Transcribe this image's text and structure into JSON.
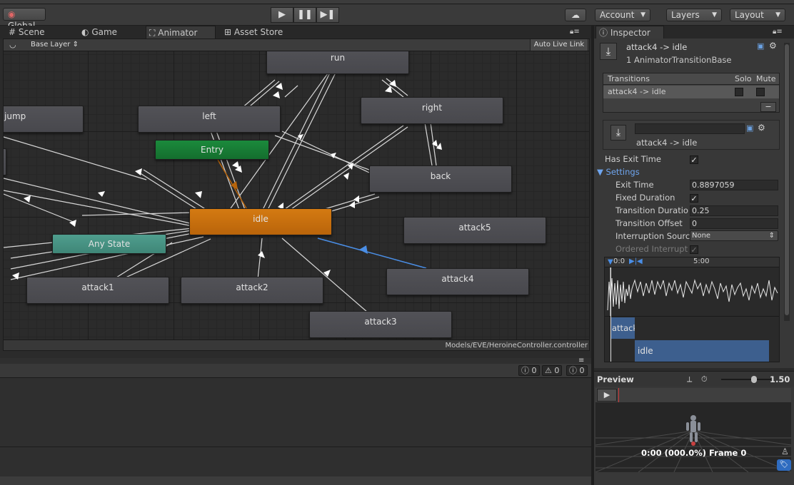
{
  "toolbar": {
    "global_label": "Global",
    "play_icon": "play-icon",
    "pause_icon": "pause-icon",
    "step_icon": "step-icon",
    "cloud_icon": "cloud-icon",
    "account_label": "Account",
    "layers_label": "Layers",
    "layout_label": "Layout"
  },
  "tabs": {
    "scene": "Scene",
    "game": "Game",
    "animator": "Animator",
    "asset_store": "Asset Store",
    "inspector": "Inspector"
  },
  "animator": {
    "layer_label": "Base Layer",
    "auto_live_link": "Auto Live Link",
    "controller_path": "Models/EVE/HeroineController.controller",
    "nodes": {
      "run": "run",
      "jump": "jump",
      "left": "left",
      "right": "right",
      "entry": "Entry",
      "back": "back",
      "idle": "idle",
      "any_state": "Any State",
      "attack5": "attack5",
      "attack4": "attack4",
      "attack1": "attack1",
      "attack2": "attack2",
      "attack3": "attack3"
    },
    "colors": {
      "idle": "#d47a12",
      "entry": "#1b8a3c",
      "any_state": "#4f9e8e",
      "selected_transition": "#4a8ee6"
    }
  },
  "console": {
    "info_count": "0",
    "warn_count": "0",
    "error_count": "0"
  },
  "inspector": {
    "title": "attack4 -> idle",
    "subtitle": "1 AnimatorTransitionBase",
    "transitions_header": "Transitions",
    "solo_header": "Solo",
    "mute_header": "Mute",
    "transition_item": "attack4 -> idle",
    "minus_label": "−",
    "name_field_value": "",
    "transition_name": "attack4 -> idle",
    "has_exit_time_label": "Has Exit Time",
    "settings_label": "Settings",
    "exit_time_label": "Exit Time",
    "exit_time_value": "0.8897059",
    "fixed_duration_label": "Fixed Duration",
    "transition_duration_label": "Transition Duratio",
    "transition_duration_value": "0.25",
    "transition_offset_label": "Transition Offset",
    "transition_offset_value": "0",
    "interruption_source_label": "Interruption Sourc",
    "interruption_source_value": "None",
    "ordered_interrupt_label": "Ordered Interrupt",
    "timeline_start": "0:0",
    "timeline_mid": "5:00",
    "timeline_attack_label": "attack",
    "timeline_idle_label": "idle"
  },
  "preview": {
    "title": "Preview",
    "speed": "1.50",
    "status": "0:00 (000.0%) Frame 0"
  }
}
